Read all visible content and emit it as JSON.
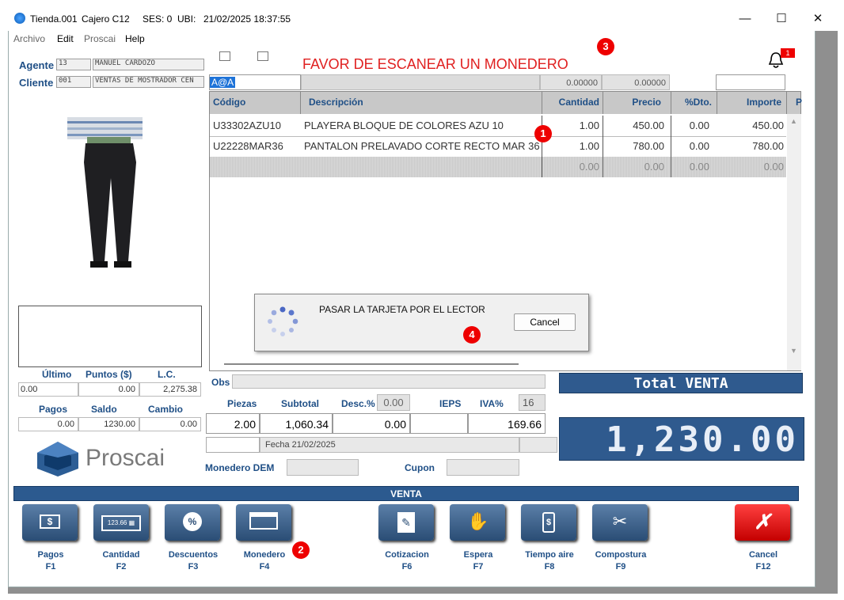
{
  "titlebar": {
    "store": "Tienda.001",
    "cashier": "Cajero C12",
    "ses": "SES: 0",
    "ubi": "UBI:",
    "datetime": "21/02/2025 18:37:55"
  },
  "window_controls": {
    "minimize": "—",
    "maximize": "☐",
    "close": "✕"
  },
  "menu": [
    "Archivo",
    "Edit",
    "Proscai",
    "Help"
  ],
  "agent": {
    "label": "Agente",
    "code": "13",
    "name": "MANUEL CARDOZO"
  },
  "client": {
    "label": "Cliente",
    "code": "001",
    "name": "VENTAS DE MOSTRADOR CEN"
  },
  "banner": "FAVOR DE ESCANEAR UN MONEDERO",
  "notification_count": "1",
  "scan": {
    "input": "A@A",
    "qty_top": "0.00000",
    "price_top": "0.00000"
  },
  "table": {
    "headers": [
      "Código",
      "Descripción",
      "Cantidad",
      "Precio",
      "%Dto.",
      "Importe",
      "P"
    ],
    "rows": [
      [
        "U33302AZU10",
        "PLAYERA BLOQUE DE COLORES AZU 10",
        "1.00",
        "450.00",
        "0.00",
        "450.00"
      ],
      [
        "U22228MAR36",
        "PANTALON PRELAVADO CORTE RECTO MAR 36",
        "1.00",
        "780.00",
        "0.00",
        "780.00"
      ],
      [
        "",
        "",
        "0.00",
        "0.00",
        "0.00",
        "0.00"
      ]
    ]
  },
  "dialog": {
    "message": "PASAR LA TARJETA POR EL LECTOR",
    "cancel": "Cancel"
  },
  "stats": {
    "ultimo_label": "Último",
    "puntos_label": "Puntos ($)",
    "lc_label": "L.C.",
    "ultimo": "0.00",
    "puntos": "0.00",
    "lc": "2,275.38",
    "pagos_label": "Pagos",
    "saldo_label": "Saldo",
    "cambio_label": "Cambio",
    "pagos": "0.00",
    "saldo": "1230.00",
    "cambio": "0.00"
  },
  "logo": "Proscai",
  "obs_label": "Obs",
  "summary": {
    "piezas_label": "Piezas",
    "subtotal_label": "Subtotal",
    "desc_label": "Desc.%",
    "desc_pct": "0.00",
    "ieps_label": "IEPS",
    "iva_label": "IVA%",
    "iva_pct": "16",
    "piezas": "2.00",
    "subtotal": "1,060.34",
    "desc": "0.00",
    "ieps": "",
    "iva": "169.66"
  },
  "fecha": "Fecha 21/02/2025",
  "monedero_label": "Monedero DEM",
  "cupon_label": "Cupon",
  "total_label": "Total VENTA",
  "total_value": "1,230.00",
  "section_bar": "VENTA",
  "buttons": [
    {
      "name": "Pagos",
      "key": "F1",
      "icon": "dollar-bill-icon"
    },
    {
      "name": "Cantidad",
      "key": "F2",
      "icon": "calculator-icon"
    },
    {
      "name": "Descuentos",
      "key": "F3",
      "icon": "percent-badge-icon"
    },
    {
      "name": "Monedero",
      "key": "F4",
      "icon": "card-icon"
    },
    {
      "name": "Cotizacion",
      "key": "F6",
      "icon": "document-pen-icon"
    },
    {
      "name": "Espera",
      "key": "F7",
      "icon": "hand-icon"
    },
    {
      "name": "Tiempo aire",
      "key": "F8",
      "icon": "phone-dollar-icon"
    },
    {
      "name": "Compostura",
      "key": "F9",
      "icon": "scissors-icon"
    },
    {
      "name": "Cancel",
      "key": "F12",
      "icon": "cancel-x-icon"
    }
  ],
  "annotations": [
    "1",
    "2",
    "3",
    "4"
  ],
  "colors": {
    "accent": "#1f4f86",
    "banner_red": "#e02020",
    "total_bg": "#2f5a8e"
  }
}
